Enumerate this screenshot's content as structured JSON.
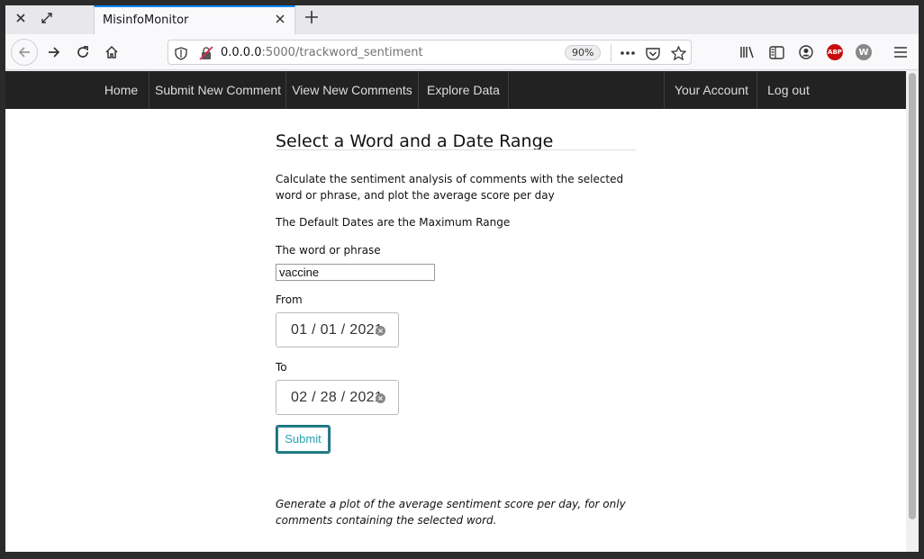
{
  "browser": {
    "tab_title": "MisinfoMonitor",
    "url_host": "0.0.0.0",
    "url_rest": ":5000/trackword_sentiment",
    "zoom": "90%",
    "icons": [
      "close-window-icon",
      "restore-window-icon",
      "back-icon",
      "forward-icon",
      "reload-icon",
      "home-icon",
      "shield-icon",
      "insecure-lock-icon",
      "more-icon",
      "pocket-icon",
      "star-icon",
      "library-icon",
      "sidebar-icon",
      "account-icon",
      "adblock-icon",
      "extension-w-icon",
      "menu-icon"
    ],
    "abp_label": "ABP",
    "w_label": "W"
  },
  "sitenav": {
    "items": [
      {
        "label": "Home"
      },
      {
        "label": "Submit New Comment"
      },
      {
        "label": "View New Comments"
      },
      {
        "label": "Explore Data"
      }
    ],
    "right_items": [
      {
        "label": "Your Account"
      },
      {
        "label": "Log out"
      }
    ]
  },
  "form": {
    "heading": "Select a Word and a Date Range",
    "description": "Calculate the sentiment analysis of comments with the selected word or phrase, and plot the average score per day",
    "default_note": "The Default Dates are the Maximum Range",
    "word_label": "The word or phrase",
    "word_value": "vaccine",
    "from_label": "From",
    "from_value": "01 / 01 / 2021",
    "to_label": "To",
    "to_value": "02 / 28 / 2021",
    "submit_label": "Submit",
    "footer_note": "Generate a plot of the average sentiment score per day, for only comments containing the selected word."
  },
  "colors": {
    "nav_bg": "#222222",
    "accent": "#2aa1b1",
    "focus_ring": "#0a84ff"
  }
}
